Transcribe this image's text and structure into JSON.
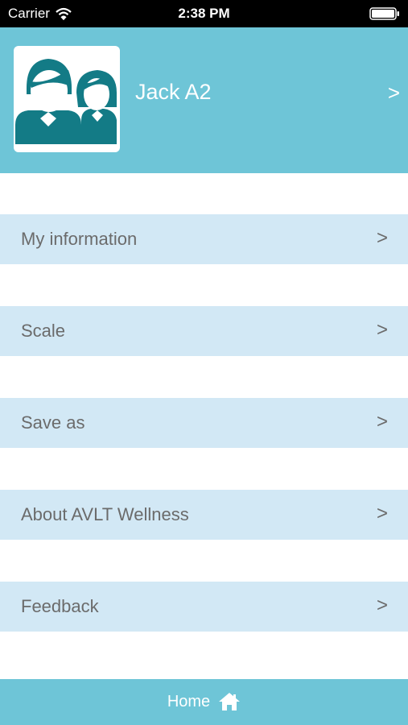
{
  "status_bar": {
    "carrier": "Carrier",
    "time": "2:38 PM",
    "wifi_icon": "wifi-icon",
    "battery_icon": "battery-icon"
  },
  "profile": {
    "name": "Jack A2",
    "chevron": ">",
    "avatar_icon": "family-avatar-icon"
  },
  "menu": {
    "items": [
      {
        "label": "My information",
        "chevron": ">"
      },
      {
        "label": "Scale",
        "chevron": ">"
      },
      {
        "label": "Save as",
        "chevron": ">"
      },
      {
        "label": "About AVLT Wellness",
        "chevron": ">"
      },
      {
        "label": "Feedback",
        "chevron": ">"
      }
    ]
  },
  "tab_bar": {
    "home_label": "Home",
    "home_icon": "home-icon"
  },
  "colors": {
    "accent": "#6ec5d7",
    "menu_background": "#d2e8f5",
    "avatar_figure": "#137b86",
    "menu_text": "#6b6b6b"
  }
}
